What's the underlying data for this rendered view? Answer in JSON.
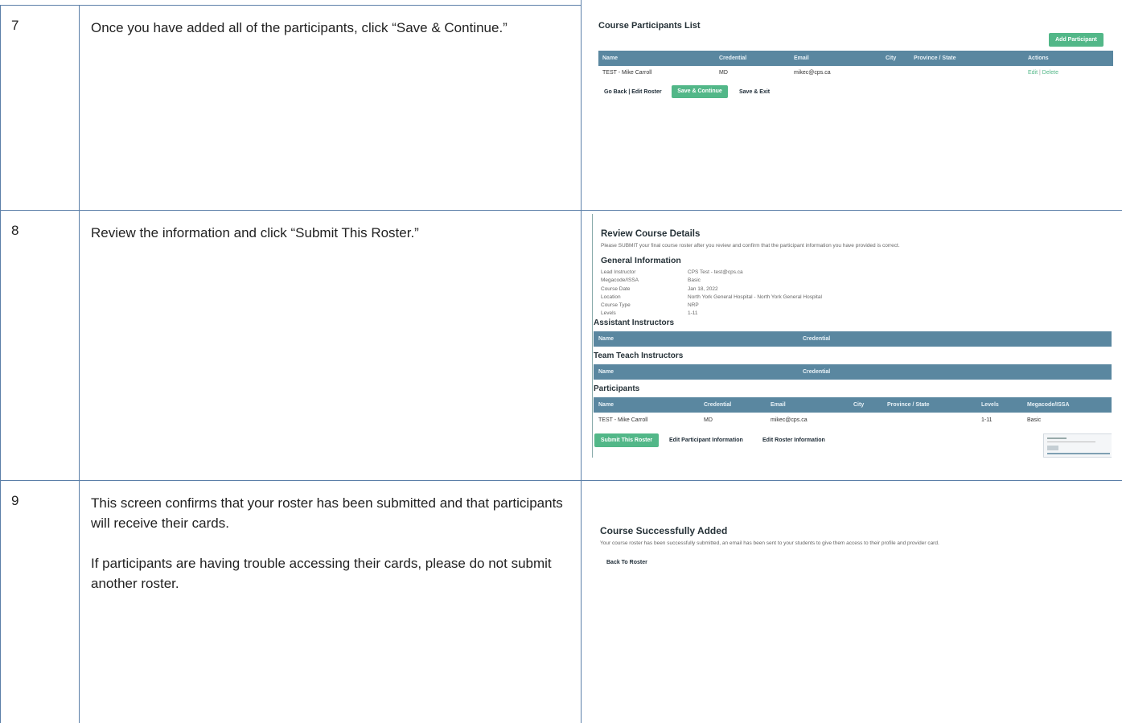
{
  "steps": [
    {
      "number": "7",
      "text": [
        "Once you have added all of the participants, click “Save & Continue.”"
      ]
    },
    {
      "number": "8",
      "text": [
        "Review the information and click “Submit This Roster.”"
      ]
    },
    {
      "number": "9",
      "text": [
        "This screen confirms that your roster has been submitted and that participants will receive their cards.",
        "If participants are having trouble accessing their cards, please do not submit another roster."
      ]
    }
  ],
  "shot1": {
    "title": "Course Participants List",
    "add_button": "Add Participant",
    "columns": [
      "Name",
      "Credential",
      "Email",
      "City",
      "Province / State",
      "Actions"
    ],
    "row": {
      "name": "TEST - Mike Carroll",
      "credential": "MD",
      "email": "mikec@cps.ca",
      "edit": "Edit",
      "sep": " | ",
      "delete": "Delete"
    },
    "go_back": "Go Back | Edit Roster",
    "save_continue": "Save & Continue",
    "save_exit": "Save & Exit"
  },
  "shot2": {
    "title": "Review Course Details",
    "subtitle": "Please SUBMIT your final course roster after you review and confirm that the participant information you have provided is correct.",
    "general_heading": "General Information",
    "general": [
      {
        "label": "Lead Instructor",
        "value": "CPS Test - test@cps.ca"
      },
      {
        "label": "Megacode/ISSA",
        "value": "Basic"
      },
      {
        "label": "Course Date",
        "value": "Jan 18, 2022"
      },
      {
        "label": "Location",
        "value": "North York General Hospital - North York General Hospital"
      },
      {
        "label": "Course Type",
        "value": "NRP"
      },
      {
        "label": "Levels",
        "value": "1-11"
      }
    ],
    "assistant_heading": "Assistant Instructors",
    "assistant_columns": [
      "Name",
      "Credential"
    ],
    "team_heading": "Team Teach Instructors",
    "team_columns": [
      "Name",
      "Credential"
    ],
    "participants_heading": "Participants",
    "participant_columns": [
      "Name",
      "Credential",
      "Email",
      "City",
      "Province / State",
      "Levels",
      "Megacode/ISSA"
    ],
    "participant_row": {
      "name": "TEST - Mike Carroll",
      "credential": "MD",
      "email": "mikec@cps.ca",
      "levels": "1-11",
      "megacode": "Basic"
    },
    "submit": "Submit This Roster",
    "edit_participant": "Edit Participant Information",
    "edit_roster": "Edit Roster Information"
  },
  "shot3": {
    "title": "Course Successfully Added",
    "subtitle": "Your course roster has been successfully submitted, an email has been sent to your students to give them access to their profile and provider card.",
    "back": "Back To Roster"
  },
  "colors": {
    "border": "#5b7fa8",
    "header": "#5a87a0",
    "green": "#52b788"
  }
}
